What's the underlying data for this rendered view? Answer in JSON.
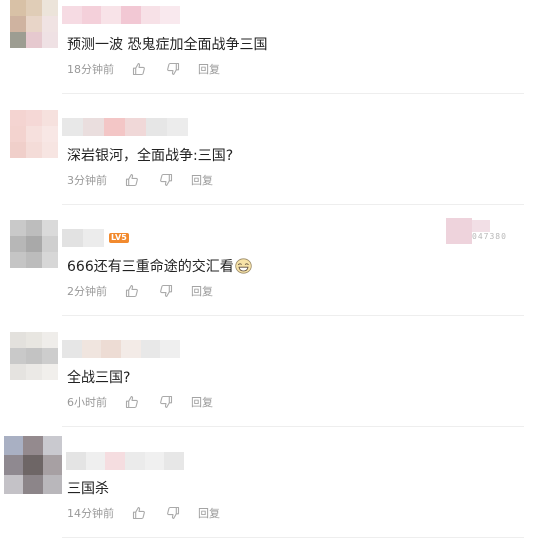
{
  "comments": [
    {
      "text": "预测一波 恐鬼症加全面战争三国",
      "time": "18分钟前",
      "reply_label": "回复",
      "avatar_colors": [
        "#d8c1a6",
        "#e0cdb7",
        "#ece4da",
        "#cfb3a0",
        "#e8d5c8",
        "#f0e3e3",
        "#9d9d92",
        "#e6c9cf",
        "#efe1e4"
      ],
      "name_colors": [
        "#f6dbe3",
        "#f4d0da",
        "#f8e3e8",
        "#f2c8d4",
        "#f7e1e7",
        "#f9e9ee"
      ]
    },
    {
      "text": "深岩银河，全面战争:三国?",
      "time": "3分钟前",
      "reply_label": "回复",
      "avatar_colors": [
        "#f4d4d1",
        "#f5d8d6",
        "#f6e1de",
        "#f3d3cf",
        "#f6e0dd",
        "#f8e7e5",
        "#f0cfca",
        "#f4dcd8",
        "#f7e5e2"
      ],
      "name_colors": [
        "#e8e8e8",
        "#eadede",
        "#f3c6c6",
        "#f0d8d8",
        "#e6e6e6",
        "#ececec"
      ]
    },
    {
      "text": "666还有三重命途的交汇看",
      "time": "2分钟前",
      "reply_label": "回复",
      "level_badge": "LV5",
      "fan_id": "047380",
      "avatar_colors": [
        "#c9c9c9",
        "#bdbdbd",
        "#dadada",
        "#b7b7b7",
        "#a9a9a9",
        "#cfcfcf",
        "#c5c5c5",
        "#bcbcbc",
        "#d7d7d7"
      ],
      "name_colors": [
        "#e2e2e2",
        "#ececec"
      ],
      "fan_colors": [
        "#eed3dc",
        "#f2dfe6"
      ]
    },
    {
      "text": "全战三国?",
      "time": "6小时前",
      "reply_label": "回复",
      "avatar_colors": [
        "#e3e1dd",
        "#e8e6e1",
        "#efedea",
        "#c9c9c9",
        "#c3c3c3",
        "#cdcdcd",
        "#e5e3e0",
        "#ebe9e6",
        "#f1efec"
      ],
      "name_colors": [
        "#e6e6e6",
        "#f0e5df",
        "#eddcd4",
        "#f3ebe7",
        "#e8e8e8",
        "#efefef"
      ]
    },
    {
      "text": "三国杀",
      "time": "14分钟前",
      "reply_label": "回复",
      "avatar_colors": [
        "#a9b0c3",
        "#948a8e",
        "#c9c9cf",
        "#8f8990",
        "#6e6666",
        "#a7a0a3",
        "#c4c2c7",
        "#8c8589",
        "#b9b7bb"
      ],
      "name_colors": [
        "#e4e4e4",
        "#efefef",
        "#f5dde0",
        "#ebebeb",
        "#f0f0f0",
        "#e7e7e7"
      ]
    }
  ]
}
